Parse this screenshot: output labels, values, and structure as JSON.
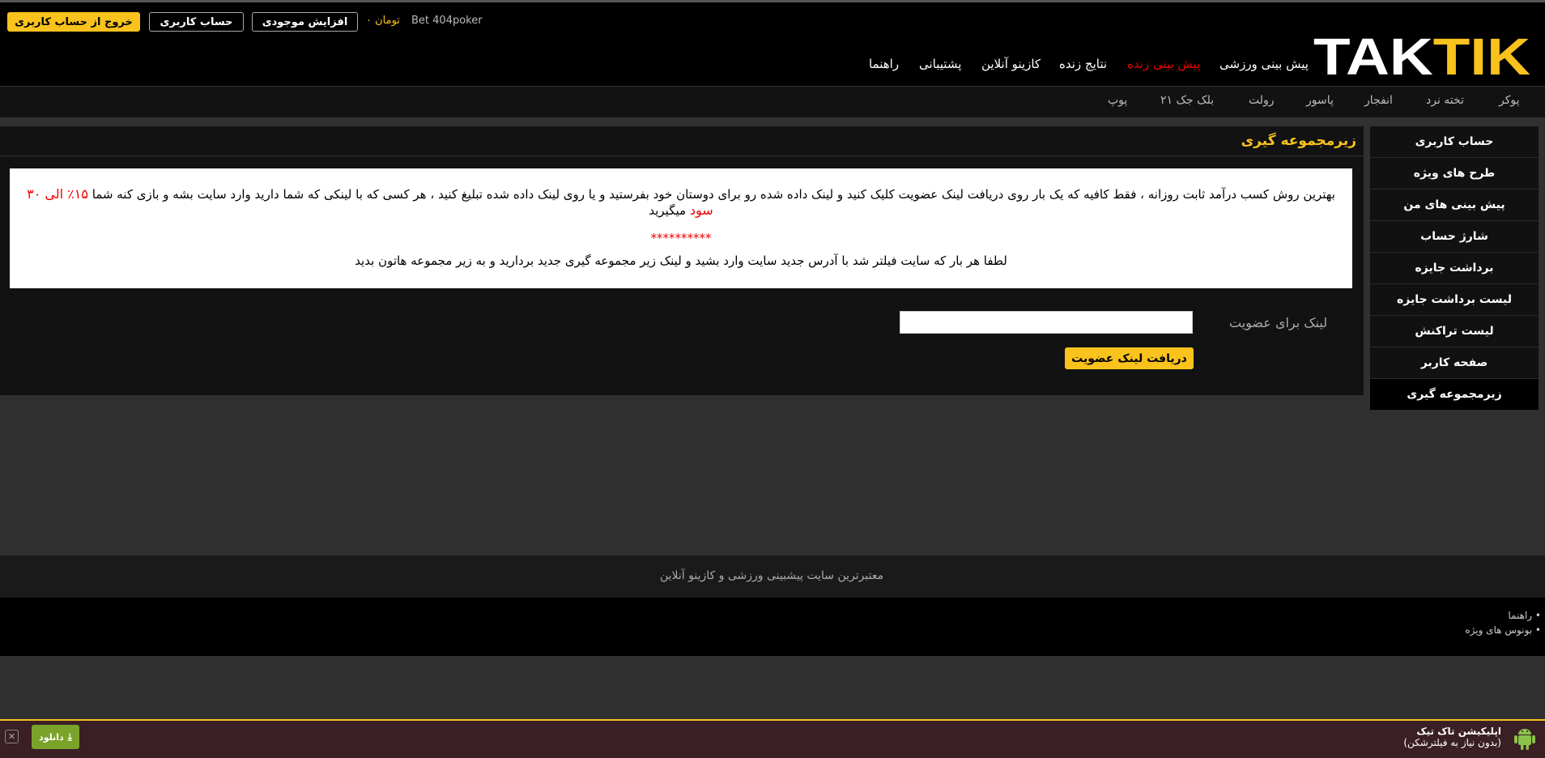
{
  "header": {
    "logout_label": "خروج از حساب کاربری",
    "account_label": "حساب کاربری",
    "deposit_label": "افزایش موجودی",
    "balance": "تومان ۰",
    "username": "Bet 404poker",
    "logo_text": "TAKTIK",
    "accent_color": "#f9c21d"
  },
  "nav": {
    "items": [
      "پیش بینی ورزشی",
      "پیش بینی زنده",
      "نتایج زنده",
      "کازینو آنلاین",
      "پشتیبانی",
      "راهنما"
    ],
    "live_color": "#e00"
  },
  "subnav": {
    "items": [
      "پوکر",
      "تخته نرد",
      "انفجار",
      "پاسور",
      "رولت",
      "بلک جک ۲۱",
      "پوپ"
    ]
  },
  "sidebar": {
    "items": [
      {
        "label": "حساب کاربری"
      },
      {
        "label": "طرح های ویژه"
      },
      {
        "label": "پیش بینی های من"
      },
      {
        "label": "شارژ حساب"
      },
      {
        "label": "برداشت جایزه"
      },
      {
        "label": "لیست برداشت جایزه"
      },
      {
        "label": "لیست تراکنش"
      },
      {
        "label": "صفحه کاربر"
      },
      {
        "label": "زیرمجموعه گیری"
      }
    ]
  },
  "main": {
    "title": "زیرمجموعه گیری",
    "info_text_1": "بهترین روش کسب درآمد ثابت روزانه ، فقط کافیه که یک بار روی دریافت لینک عضویت کلیک کنید و لینک داده شده رو برای دوستان خود بفرستید و یا روی لینک داده شده تبلیغ کنید ، هر کسی که با لینکی که شما دارید وارد سایت بشه و بازی کنه شما",
    "info_profit": "۱۵٪ الی ۳۰ سود",
    "info_text_2": "میگیرید",
    "stars": "**********",
    "info_text_3": "لطفا هر بار که سایت فیلتر شد با آدرس جدید سایت وارد بشید و لینک زیر مجموعه گیری جدید بردارید و به زیر مجموعه هاتون بدید",
    "link_label": "لینک برای عضویت",
    "link_value": "",
    "get_link_label": "دریافت لینک عضویت"
  },
  "footer": {
    "tagline": "معتبرترین سایت پیشبینی ورزشی و کازینو آنلاین",
    "links": [
      "• راهنما",
      "• بونوس های ویژه"
    ]
  },
  "app_banner": {
    "title": "اپلیکیشن تاک تیک",
    "subtitle": "(بدون نیاز به فیلترشکن)",
    "download_label": "دانلود",
    "icon": "android-icon"
  }
}
